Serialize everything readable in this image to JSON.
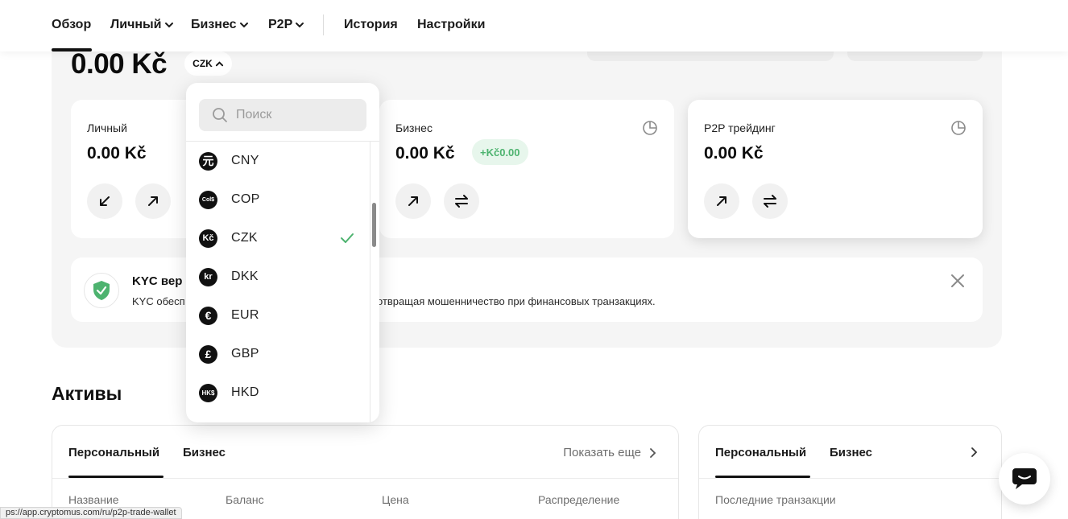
{
  "nav": {
    "overview": "Обзор",
    "personal": "Личный",
    "business": "Бизнес",
    "p2p": "P2P",
    "history": "История",
    "settings": "Настройки"
  },
  "balance": {
    "total": "0.00 Kč",
    "currency": "CZK"
  },
  "wallets": [
    {
      "title": "Личный",
      "balance": "0.00 Kč"
    },
    {
      "title": "Бизнес",
      "balance": "0.00 Kč",
      "badge": "+Kč0.00"
    },
    {
      "title": "P2P трейдинг",
      "balance": "0.00 Kč"
    }
  ],
  "kyc": {
    "title": "KYC вер",
    "desc_part1": "KYC обесп",
    "desc_part2": "отвращая мошенничество при финансовых транзакциях."
  },
  "assets": {
    "title": "Активы",
    "tabs": [
      "Персональный",
      "Бизнес"
    ],
    "show_more": "Показать еще",
    "columns": [
      "Название",
      "Баланс",
      "Цена",
      "Распределение"
    ]
  },
  "transactions": {
    "tabs": [
      "Персональный",
      "Бизнес"
    ],
    "column": "Последние транзакции"
  },
  "dropdown": {
    "search_placeholder": "Поиск",
    "selected": "CZK",
    "items": [
      {
        "code": "CNY",
        "symbol": "元"
      },
      {
        "code": "COP",
        "symbol": "Col$"
      },
      {
        "code": "CZK",
        "symbol": "Kč"
      },
      {
        "code": "DKK",
        "symbol": "kr"
      },
      {
        "code": "EUR",
        "symbol": "€"
      },
      {
        "code": "GBP",
        "symbol": "£"
      },
      {
        "code": "HKD",
        "symbol": "HK$"
      }
    ]
  },
  "status_url": "ps://app.cryptomus.com/ru/p2p-trade-wallet",
  "colors": {
    "accent_green": "#4db36f",
    "panel_bg": "#f5f5f5",
    "dark": "#111111"
  }
}
